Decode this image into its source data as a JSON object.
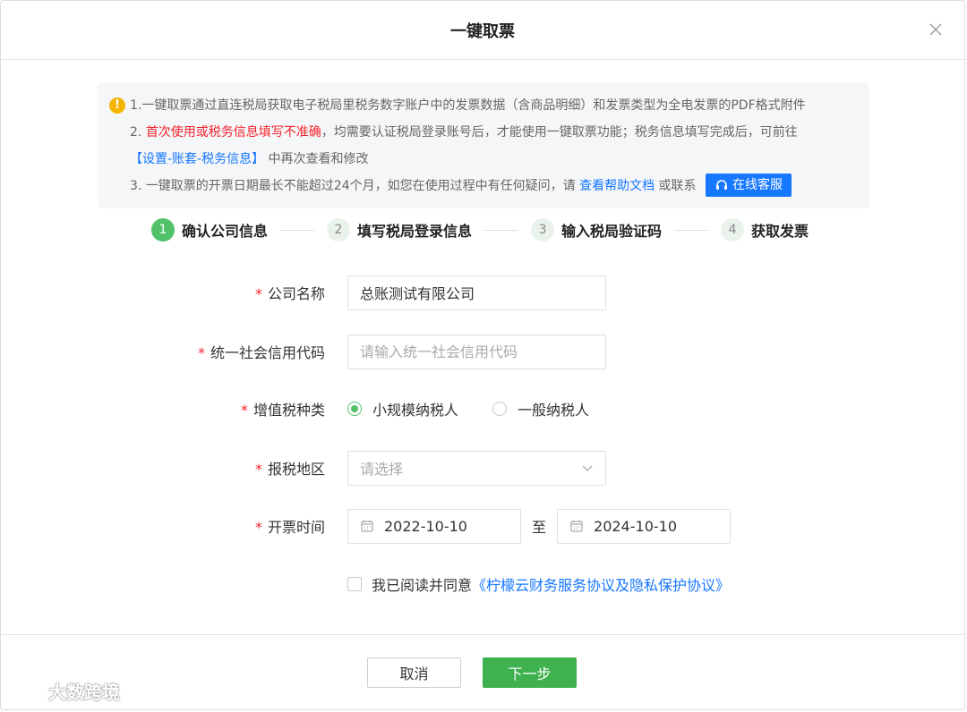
{
  "dialog": {
    "title": "一键取票",
    "close_icon": "close-icon"
  },
  "notice": {
    "line1": "1.一键取票通过直连税局获取电子税局里税务数字账户中的发票数据（含商品明细）和发票类型为全电发票的PDF格式附件",
    "line2_prefix": "2. ",
    "line2_red": "首次使用或税务信息填写不准确",
    "line2_rest": "，均需要认证税局登录账号后，才能使用一键取票功能；税务信息填写完成后，可前往",
    "line3_link": "【设置-账套-税务信息】",
    "line3_rest": " 中再次查看和修改",
    "line4_prefix": "3. 一键取票的开票日期最长不能超过24个月，如您在使用过程中有任何疑问，请 ",
    "line4_link": "查看帮助文档",
    "line4_mid": " 或联系",
    "service_button": "在线客服"
  },
  "steps": [
    {
      "num": "1",
      "label": "确认公司信息",
      "active": true
    },
    {
      "num": "2",
      "label": "填写税局登录信息",
      "active": false
    },
    {
      "num": "3",
      "label": "输入税局验证码",
      "active": false
    },
    {
      "num": "4",
      "label": "获取发票",
      "active": false
    }
  ],
  "form": {
    "company": {
      "label": "公司名称",
      "value": "总账测试有限公司"
    },
    "credit_code": {
      "label": "统一社会信用代码",
      "placeholder": "请输入统一社会信用代码"
    },
    "vat_type": {
      "label": "增值税种类",
      "options": [
        "小规模纳税人",
        "一般纳税人"
      ],
      "selected": "小规模纳税人"
    },
    "region": {
      "label": "报税地区",
      "placeholder": "请选择"
    },
    "invoice_time": {
      "label": "开票时间",
      "start": "2022-10-10",
      "separator": "至",
      "end": "2024-10-10"
    },
    "agreement": {
      "prefix": "我已阅读并同意",
      "link": "《柠檬云财务服务协议及隐私保护协议》",
      "checked": false
    }
  },
  "footer": {
    "cancel": "取消",
    "next": "下一步"
  },
  "watermark": {
    "text": "大数跨境"
  },
  "colors": {
    "primary_green": "#3fb14f",
    "link_blue": "#1677ff",
    "required_red": "#f5222d",
    "warning_yellow": "#f5b400"
  }
}
